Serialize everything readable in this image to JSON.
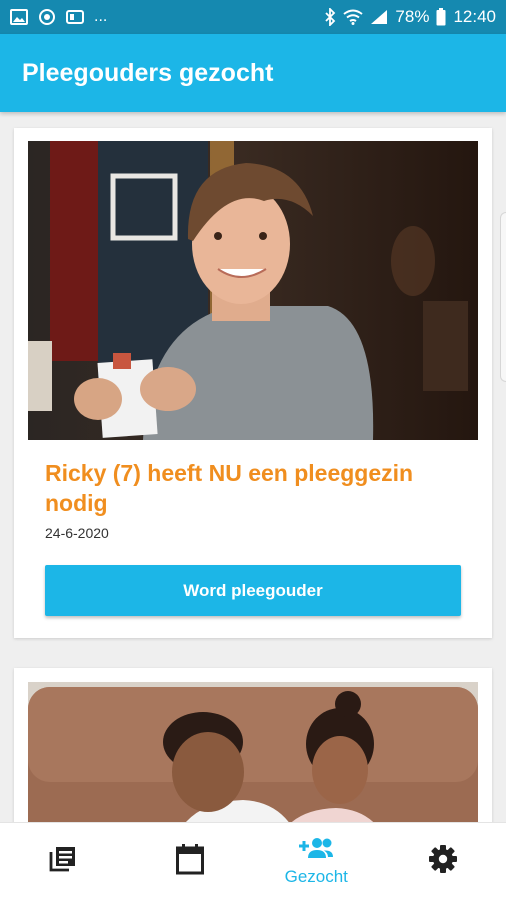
{
  "status_bar": {
    "left_icons": [
      "image-icon",
      "sync-icon",
      "sim-icon"
    ],
    "more": "...",
    "battery": "78%",
    "time": "12:40"
  },
  "app_bar": {
    "title": "Pleegouders gezocht"
  },
  "cards": [
    {
      "title": "Ricky (7) heeft NU een pleeggezin nodig",
      "date": "24-6-2020",
      "button_label": "Word pleegouder"
    }
  ],
  "bottom_nav": {
    "items": [
      {
        "icon": "news-icon",
        "label": ""
      },
      {
        "icon": "calendar-icon",
        "label": ""
      },
      {
        "icon": "add-people-icon",
        "label": "Gezocht",
        "active": true
      },
      {
        "icon": "gear-icon",
        "label": ""
      }
    ]
  },
  "colors": {
    "primary": "#1cb6e7",
    "status": "#1589b0",
    "accent": "#f08e1f"
  }
}
